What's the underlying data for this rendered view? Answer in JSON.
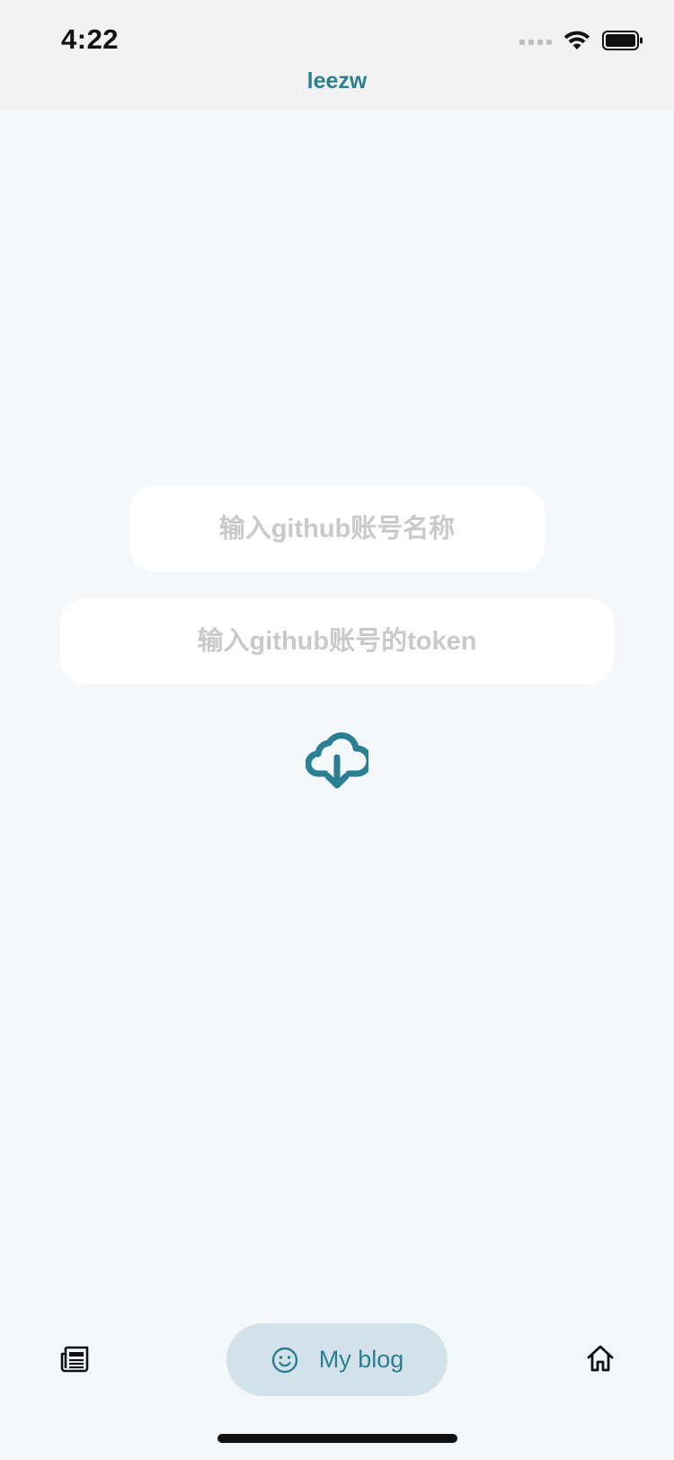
{
  "status_bar": {
    "time": "4:22"
  },
  "header": {
    "title": "leezw"
  },
  "form": {
    "username_placeholder": "输入github账号名称",
    "token_placeholder": "输入github账号的token",
    "submit_icon": "cloud-download-icon"
  },
  "bottom_nav": {
    "items": [
      {
        "icon": "newspaper-icon",
        "label": ""
      },
      {
        "icon": "smiley-icon",
        "label": "My blog",
        "active": true
      },
      {
        "icon": "home-icon",
        "label": ""
      }
    ]
  },
  "colors": {
    "accent": "#2a7f93",
    "background": "#f4f8fb",
    "header_bg": "#f2f2f2",
    "active_pill": "#d3e2ea",
    "placeholder": "#c9c9c9"
  }
}
